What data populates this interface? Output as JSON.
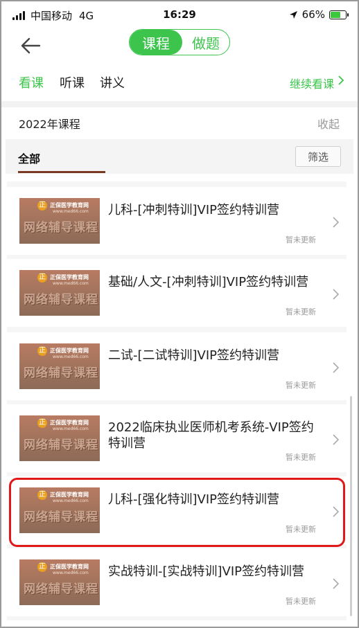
{
  "status_bar": {
    "carrier": "中国移动",
    "network": "4G",
    "time": "16:29",
    "battery": "66%",
    "battery_level": 0.66
  },
  "header": {
    "segments": [
      {
        "label": "课程",
        "active": true
      },
      {
        "label": "做题",
        "active": false
      }
    ],
    "accent_color": "#3cc44c"
  },
  "tabs": [
    {
      "label": "看课",
      "active": true
    },
    {
      "label": "听课",
      "active": false
    },
    {
      "label": "讲义",
      "active": false
    }
  ],
  "continue_link": "继续看课",
  "section": {
    "title": "2022年课程",
    "collapse_label": "收起"
  },
  "filter": {
    "all_label": "全部",
    "filter_button": "筛选"
  },
  "thumbnail": {
    "brand": "正保医学教育网",
    "site": "www.med66.com",
    "banner": "网络辅导课程"
  },
  "courses": [
    {
      "title": "儿科-[冲刺特训]VIP签约特训营",
      "status": "暂未更新"
    },
    {
      "title": "基础/人文-[冲刺特训]VIP签约特训营",
      "status": "暂未更新"
    },
    {
      "title": "二试-[二试特训]VIP签约特训营",
      "status": "暂未更新"
    },
    {
      "title": "2022临床执业医师机考系统-VIP签约特训营",
      "status": "暂未更新"
    },
    {
      "title": "儿科-[强化特训]VIP签约特训营",
      "status": "暂未更新",
      "highlighted": true
    },
    {
      "title": "实战特训-[实战特训]VIP签约特训营",
      "status": "暂未更新"
    }
  ]
}
